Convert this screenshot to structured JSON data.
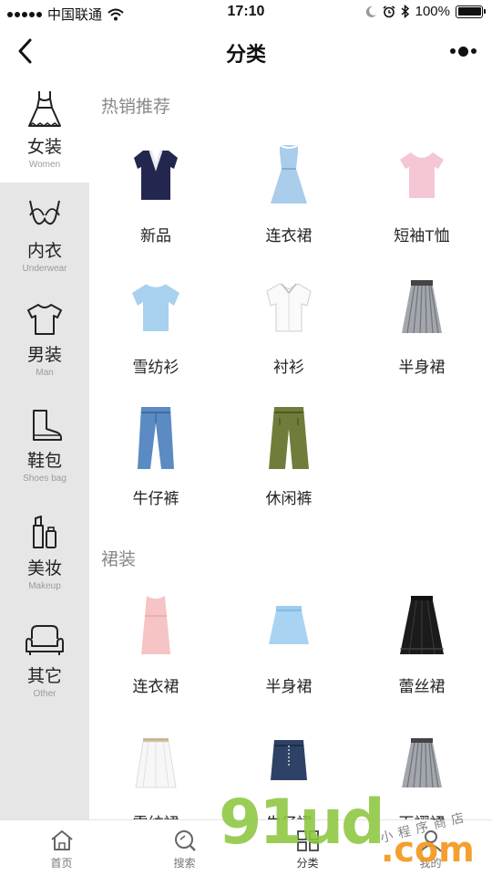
{
  "status_bar": {
    "carrier": "中国联通",
    "time": "17:10",
    "battery": "100%",
    "battery_level": 1.0,
    "icons": [
      "signal-dots",
      "wifi-icon",
      "moon-icon",
      "alarm-icon",
      "bluetooth-icon",
      "battery-icon"
    ]
  },
  "nav": {
    "title": "分类",
    "back_icon": "chevron-left-icon",
    "more_icon": "more-dots-icon"
  },
  "sidebar": {
    "items": [
      {
        "cn": "女装",
        "en": "Women",
        "icon": "dress-icon",
        "selected": true
      },
      {
        "cn": "内衣",
        "en": "Underwear",
        "icon": "bra-icon",
        "selected": false
      },
      {
        "cn": "男装",
        "en": "Man",
        "icon": "tshirt-icon",
        "selected": false
      },
      {
        "cn": "鞋包",
        "en": "Shoes bag",
        "icon": "boot-icon",
        "selected": false
      },
      {
        "cn": "美妆",
        "en": "Makeup",
        "icon": "lipstick-icon",
        "selected": false
      },
      {
        "cn": "其它",
        "en": "Other",
        "icon": "sofa-icon",
        "selected": false
      }
    ]
  },
  "sections": [
    {
      "title": "热销推荐",
      "items": [
        {
          "label": "新品",
          "icon": "vneck-top-icon"
        },
        {
          "label": "连衣裙",
          "icon": "blue-dress-icon"
        },
        {
          "label": "短袖T恤",
          "icon": "pink-tee-icon"
        },
        {
          "label": "雪纺衫",
          "icon": "chiffon-blouse-icon"
        },
        {
          "label": "衬衫",
          "icon": "white-shirt-icon"
        },
        {
          "label": "半身裙",
          "icon": "pleated-skirt-icon"
        },
        {
          "label": "牛仔裤",
          "icon": "jeans-icon"
        },
        {
          "label": "休闲裤",
          "icon": "casual-pants-icon"
        }
      ]
    },
    {
      "title": "裙装",
      "items": [
        {
          "label": "连衣裙",
          "icon": "pink-dress-icon"
        },
        {
          "label": "半身裙",
          "icon": "blue-skirt-icon"
        },
        {
          "label": "蕾丝裙",
          "icon": "lace-skirt-icon"
        },
        {
          "label": "雪纺裙",
          "icon": "white-skirt-icon"
        },
        {
          "label": "牛仔裙",
          "icon": "denim-skirt-icon"
        },
        {
          "label": "百褶裙",
          "icon": "pleated-skirt-icon"
        }
      ]
    }
  ],
  "tabbar": {
    "tabs": [
      {
        "label": "首页",
        "icon": "home-icon",
        "active": false
      },
      {
        "label": "搜索",
        "icon": "search-icon",
        "active": false
      },
      {
        "label": "分类",
        "icon": "category-icon",
        "active": true
      },
      {
        "label": "我的",
        "icon": "user-icon",
        "active": false
      }
    ]
  },
  "watermark": {
    "main": "91ud",
    "suffix": ".com",
    "caption": "小程序商店"
  },
  "colors": {
    "sidebar_gray": "#e6e6e6",
    "section_title": "#888888",
    "watermark_green": "#8cc63f",
    "watermark_orange": "#f4971c"
  }
}
